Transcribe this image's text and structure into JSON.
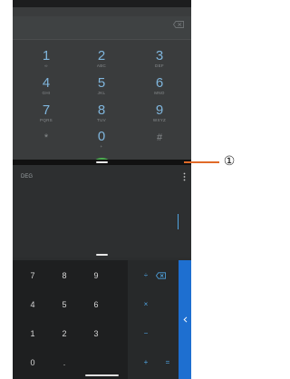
{
  "dialer": {
    "keys": [
      {
        "digit": "1",
        "letters": "∞"
      },
      {
        "digit": "2",
        "letters": "ABC"
      },
      {
        "digit": "3",
        "letters": "DEF"
      },
      {
        "digit": "4",
        "letters": "GHI"
      },
      {
        "digit": "5",
        "letters": "JKL"
      },
      {
        "digit": "6",
        "letters": "MNO"
      },
      {
        "digit": "7",
        "letters": "PQRS"
      },
      {
        "digit": "8",
        "letters": "TUV"
      },
      {
        "digit": "9",
        "letters": "WXYZ"
      },
      {
        "digit": "*",
        "letters": ""
      },
      {
        "digit": "0",
        "letters": "+"
      },
      {
        "digit": "#",
        "letters": ""
      }
    ],
    "call_icon": "phone-icon",
    "backspace_icon": "backspace-icon"
  },
  "calculator": {
    "mode": "DEG",
    "number_keys": [
      "7",
      "8",
      "9",
      "4",
      "5",
      "6",
      "1",
      "2",
      "3",
      "0",
      "."
    ],
    "operators": [
      "÷",
      "×",
      "−",
      "+",
      "="
    ],
    "delete_icon": "backspace-icon",
    "panel_icon": "chevron-left-icon"
  },
  "callout": {
    "label": "①",
    "color": "#e06a28"
  }
}
